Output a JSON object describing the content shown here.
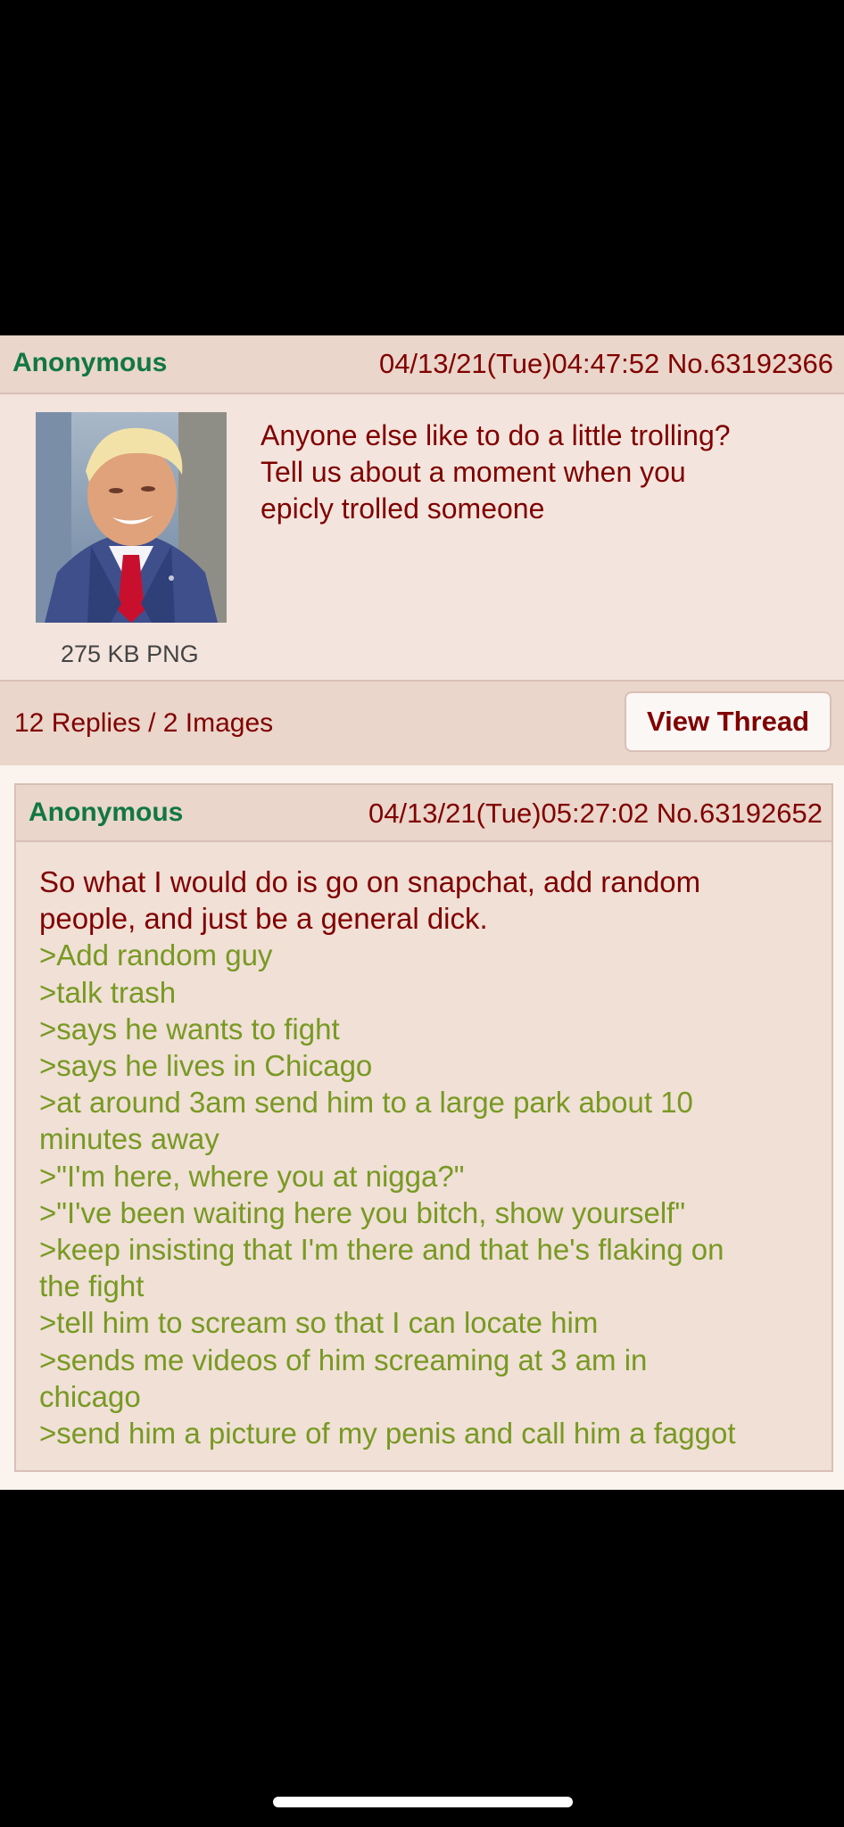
{
  "op": {
    "name": "Anonymous",
    "meta": "04/13/21(Tue)04:47:52 No.63192366",
    "text_lines": [
      "Anyone else like to do a little trolling?",
      "Tell us about a moment when you",
      "epicly trolled someone"
    ],
    "file_info": "275 KB PNG",
    "replies_summary": "12 Replies / 2 Images",
    "view_thread_label": "View Thread"
  },
  "reply": {
    "name": "Anonymous",
    "meta": "04/13/21(Tue)05:27:02 No.63192652",
    "lines": [
      {
        "text": "So what I would do is go on snapchat, add random",
        "quote": false
      },
      {
        "text": "people, and just be a general dick.",
        "quote": false
      },
      {
        "text": ">Add random guy",
        "quote": true
      },
      {
        "text": ">talk trash",
        "quote": true
      },
      {
        "text": ">says he wants to fight",
        "quote": true
      },
      {
        "text": ">says he lives in Chicago",
        "quote": true
      },
      {
        "text": ">at around 3am send him to a large park about 10",
        "quote": true
      },
      {
        "text": "minutes away",
        "quote": true
      },
      {
        "text": ">\"I'm here, where you at nigga?\"",
        "quote": true
      },
      {
        "text": ">\"I've been waiting here you bitch, show yourself\"",
        "quote": true
      },
      {
        "text": ">keep insisting that I'm there and that he's flaking on",
        "quote": true
      },
      {
        "text": "the fight",
        "quote": true
      },
      {
        "text": ">tell him to scream so that I can locate him",
        "quote": true
      },
      {
        "text": ">sends me videos of him screaming at 3 am in",
        "quote": true
      },
      {
        "text": "chicago",
        "quote": true
      },
      {
        "text": ">send him a picture of my penis and call him a faggot",
        "quote": true
      }
    ]
  },
  "colors": {
    "name": "#117743",
    "post_text": "#800000",
    "greentext": "#789922",
    "post_bg": "#f0e0d6",
    "header_bg": "#ead6ca"
  }
}
